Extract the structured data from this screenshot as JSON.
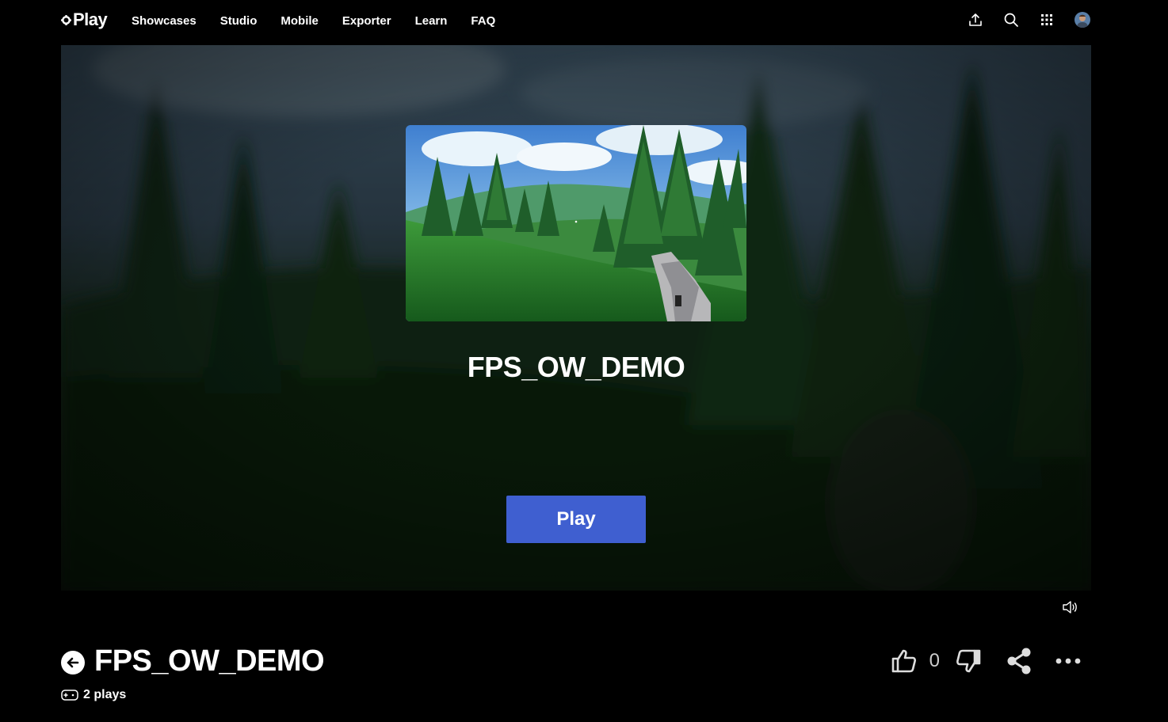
{
  "brand": {
    "name": "Play",
    "logo_icon": "gear-logo-icon"
  },
  "nav": {
    "links": [
      "Showcases",
      "Studio",
      "Mobile",
      "Exporter",
      "Learn",
      "FAQ"
    ],
    "icons": [
      "upload-icon",
      "search-icon",
      "apps-grid-icon",
      "avatar"
    ]
  },
  "stage": {
    "title": "FPS_OW_DEMO",
    "play_label": "Play",
    "play_color": "#3f5fd0"
  },
  "game": {
    "title": "FPS_OW_DEMO",
    "plays": "2 plays",
    "likes": "0"
  }
}
